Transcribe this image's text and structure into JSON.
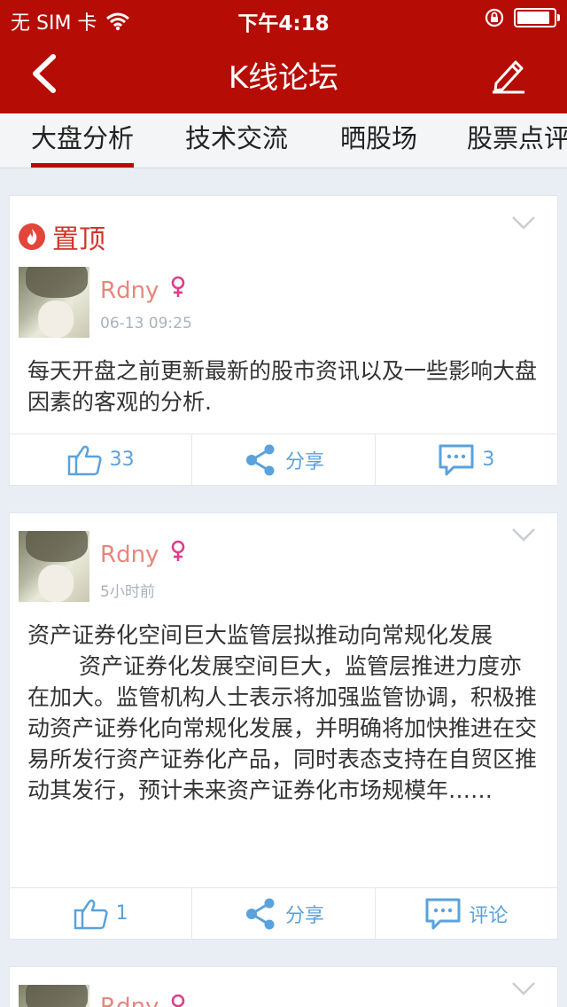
{
  "status": {
    "carrier": "无 SIM 卡",
    "time": "下午4:18"
  },
  "nav": {
    "title": "K线论坛"
  },
  "tabs": [
    "大盘分析",
    "技术交流",
    "晒股场",
    "股票点评"
  ],
  "posts": [
    {
      "pin_label": "置顶",
      "user": "Rdny",
      "time": "06-13 09:25",
      "content": "每天开盘之前更新最新的股市资讯以及一些影响大盘因素的客观的分析.",
      "likes": "33",
      "share": "分享",
      "comments": "3"
    },
    {
      "user": "Rdny",
      "time": "5小时前",
      "title": "资产证券化空间巨大监管层拟推动向常规化发展",
      "body": "资产证券化发展空间巨大，监管层推进力度亦在加大。监管机构人士表示将加强监管协调，积极推动资产证券化向常规化发展，并明确将加快推进在交易所发行资产证券化产品，同时表态支持在自贸区推动其发行，预计未来资产证券化市场规模年……",
      "likes": "1",
      "share": "分享",
      "comments": "评论"
    },
    {
      "user": "Rdny"
    }
  ],
  "colors": {
    "brand": "#b50d05",
    "link": "#5aa2dc",
    "username": "#e8857a",
    "gender": "#e03c8a"
  }
}
